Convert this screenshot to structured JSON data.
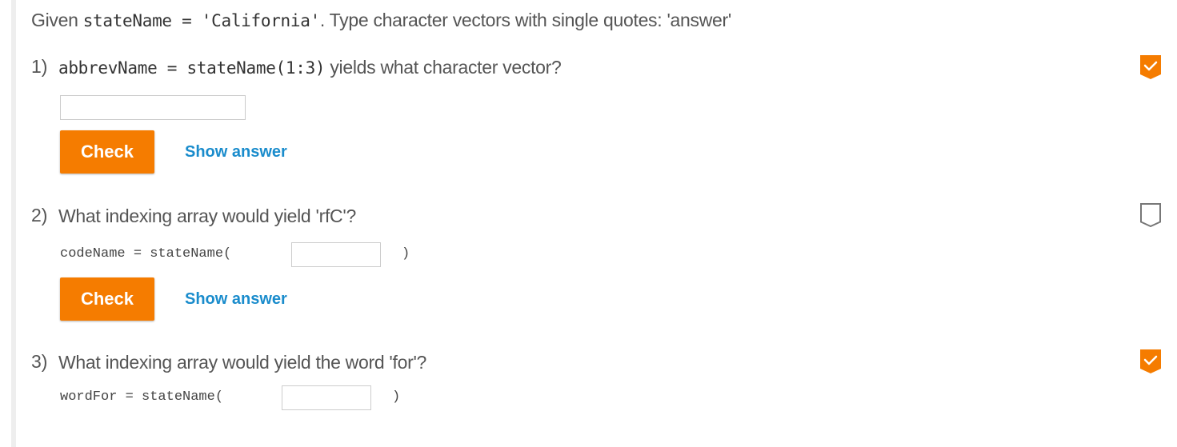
{
  "intro": {
    "prefix": "Given ",
    "code": "stateName = 'California'",
    "suffix": ". Type character vectors with single quotes: 'answer'"
  },
  "questions": [
    {
      "number": "1)",
      "code": "abbrevName = stateName(1:3)",
      "text": " yields what character vector?",
      "input_value": "",
      "check_label": "Check",
      "show_answer_label": "Show answer",
      "status": "completed"
    },
    {
      "number": "2)",
      "text": "What indexing array would yield 'rfC'?",
      "code_prefix": "codeName = stateName(",
      "code_suffix": ")",
      "input_value": "",
      "check_label": "Check",
      "show_answer_label": "Show answer",
      "status": "incomplete"
    },
    {
      "number": "3)",
      "text": "What indexing array would yield the word 'for'?",
      "code_prefix": "wordFor = stateName(",
      "code_suffix": ")",
      "input_value": "",
      "status": "completed"
    }
  ],
  "colors": {
    "accent": "#f57c00",
    "link": "#1a8ccc",
    "incomplete_border": "#777777"
  }
}
